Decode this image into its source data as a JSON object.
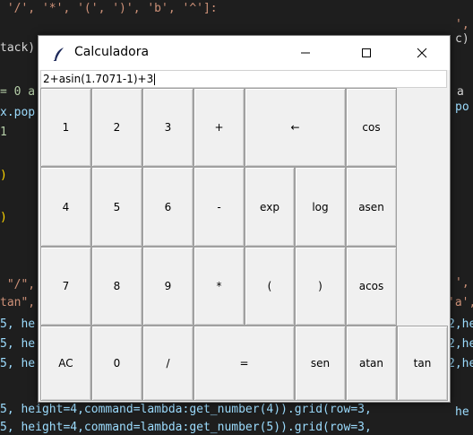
{
  "editor": {
    "lines": [
      {
        "text": " '/', '*', '(', ')', 'b', '^']:",
        "color": "#ce9178"
      },
      {
        "text": "tack)",
        "color": "#d4d4d4"
      },
      {
        "text": "= 0 a",
        "color": "#b5cea8"
      },
      {
        "text": "x.pop",
        "color": "#9cdcfe"
      },
      {
        "text": "1",
        "color": "#b5cea8"
      },
      {
        "text": ")",
        "color": "#ffd700"
      },
      {
        "text": ")",
        "color": "#ffd700"
      },
      {
        "text": " \"/\",",
        "color": "#ce9178"
      },
      {
        "text": "tan\",",
        "color": "#ce9178"
      },
      {
        "text": "5, he",
        "color": "#9cdcfe"
      },
      {
        "text": "5, he",
        "color": "#9cdcfe"
      },
      {
        "text": "5, he",
        "color": "#9cdcfe"
      },
      {
        "text": "5, height=4,command=lambda:get_number(4)).grid(row=3,",
        "color": "#9cdcfe"
      },
      {
        "text": "5, height=4,command=lambda:get_number(5)).grid(row=3,",
        "color": "#9cdcfe"
      }
    ],
    "right_lines": [
      "',",
      "c)",
      "a",
      "po",
      "',",
      "'a',",
      "2,he",
      "2,he",
      "2,he",
      "he"
    ]
  },
  "window": {
    "title": "Calculadora",
    "display_value": "2+asin(1.7071-1)+3"
  },
  "buttons": {
    "b1": "1",
    "b2": "2",
    "b3": "3",
    "plus": "+",
    "back": "←",
    "cos": "cos",
    "b4": "4",
    "b5": "5",
    "b6": "6",
    "minus": "-",
    "exp": "exp",
    "log": "log",
    "asen": "asen",
    "b7": "7",
    "b8": "8",
    "b9": "9",
    "mult": "*",
    "lparen": "(",
    "rparen": ")",
    "acos": "acos",
    "ac": "AC",
    "b0": "0",
    "div": "/",
    "equals": "=",
    "sen": "sen",
    "atan": "atan",
    "tan": "tan"
  }
}
